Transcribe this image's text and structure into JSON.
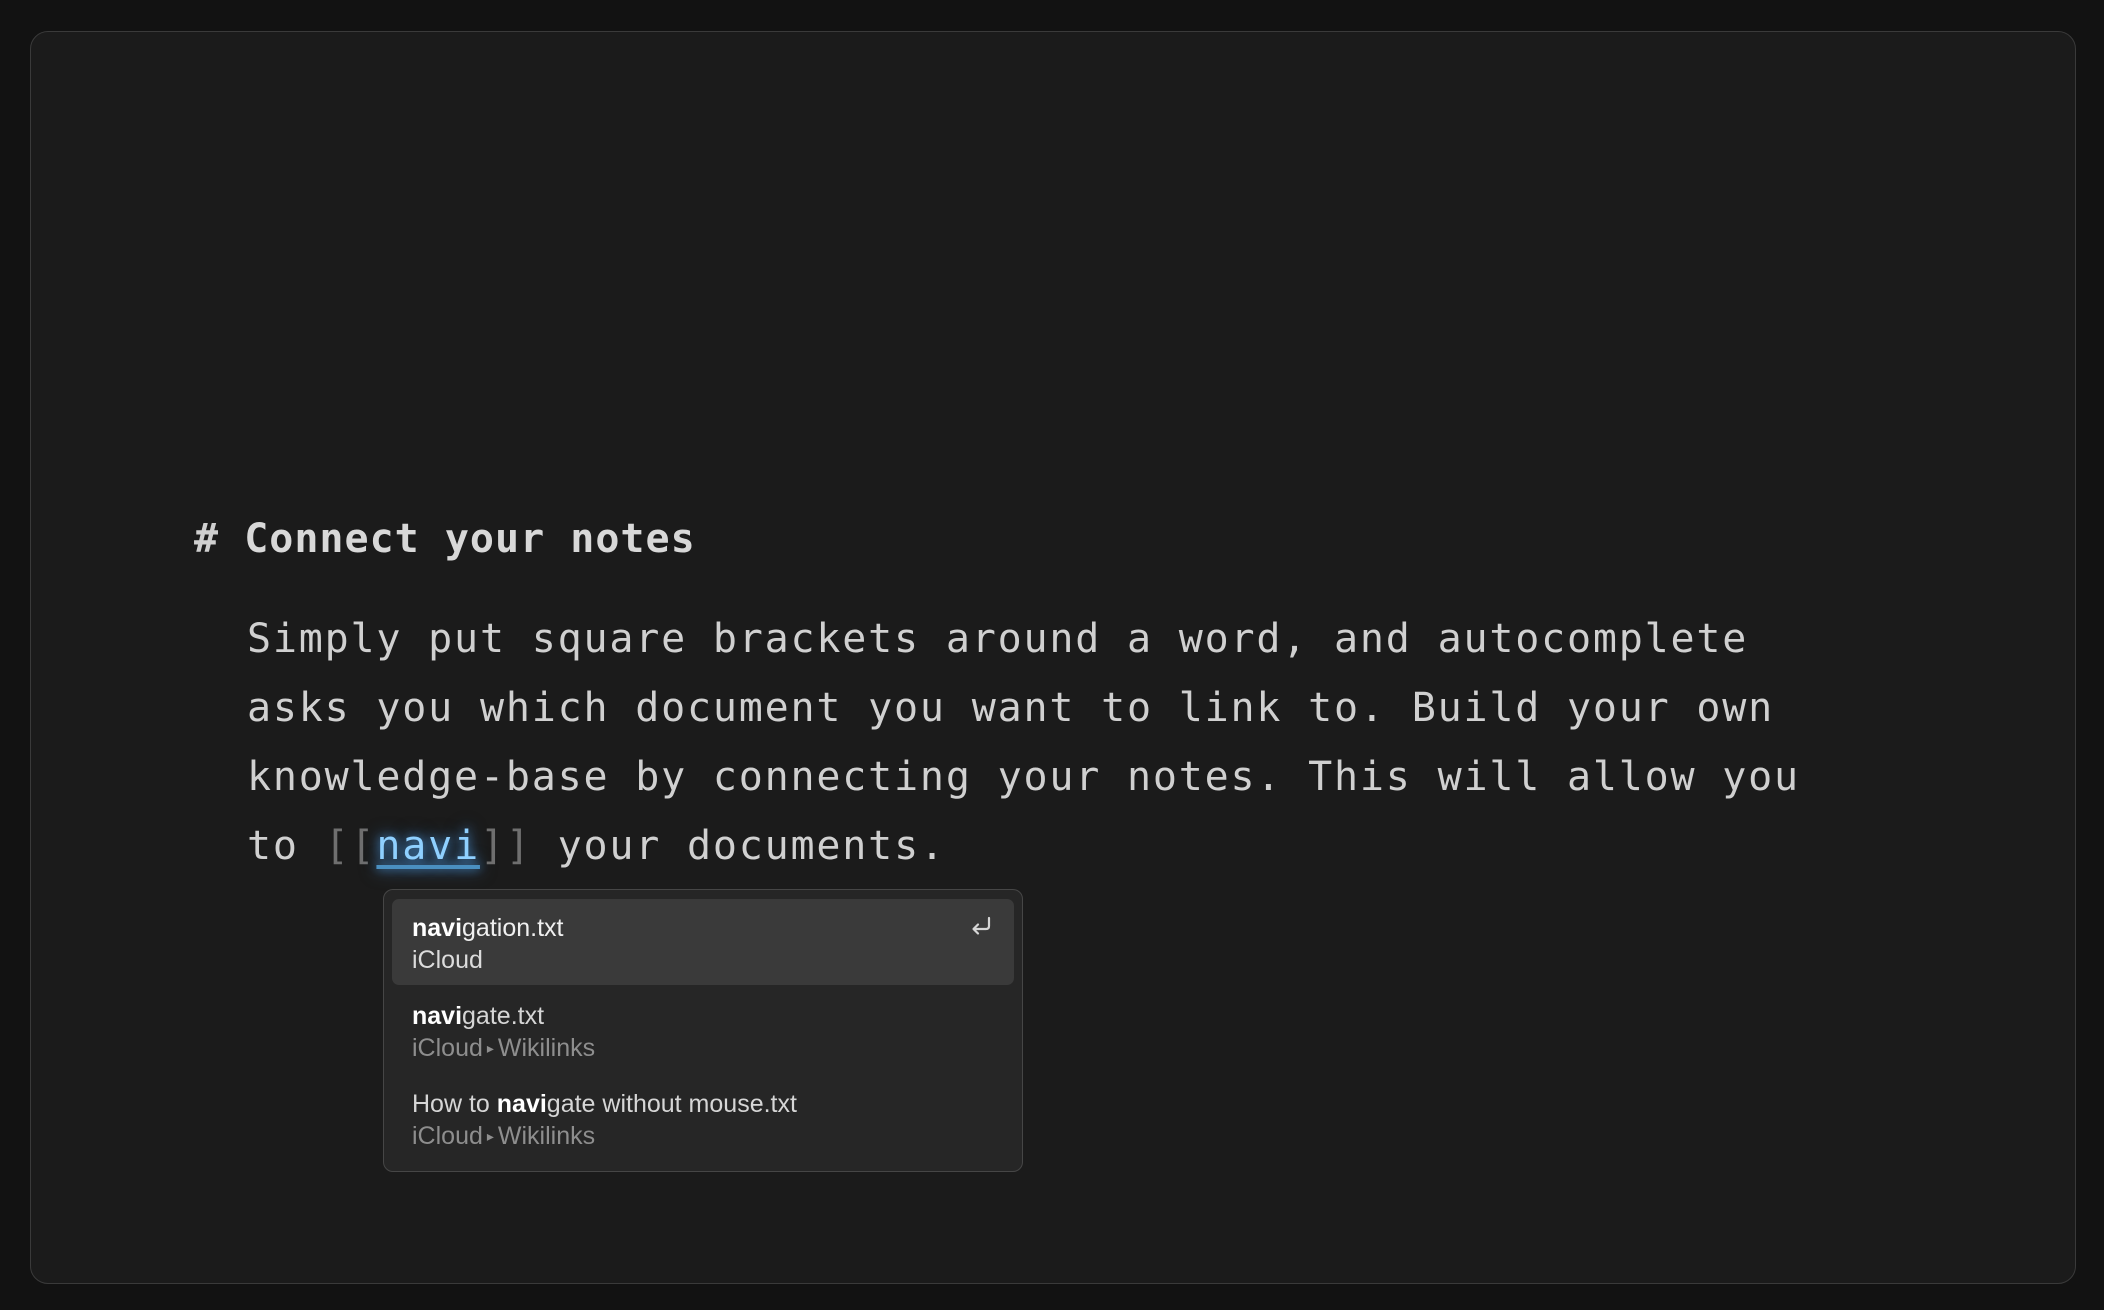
{
  "editor": {
    "heading": {
      "marker": "#",
      "text": "Connect your notes"
    },
    "paragraph": {
      "line1": "Simply put square brackets around a word, and autocomplete",
      "line2": "asks you which document you want to link to. Build your own",
      "line3": "knowledge-base by connecting your notes. This will allow you",
      "line4_prefix": "to ",
      "open_bracket": "[[",
      "query": "navi",
      "close_bracket": "]]",
      "line4_suffix": " your documents."
    }
  },
  "autocomplete": {
    "selected_index": 0,
    "enter_icon": "return-key-icon",
    "items": [
      {
        "title_before": "",
        "title_match": "navi",
        "title_after": "gation.txt",
        "location": [
          "iCloud"
        ]
      },
      {
        "title_before": "",
        "title_match": "navi",
        "title_after": "gate.txt",
        "location": [
          "iCloud",
          "Wikilinks"
        ]
      },
      {
        "title_before": "How to ",
        "title_match": "navi",
        "title_after": "gate without mouse.txt",
        "location": [
          "iCloud",
          "Wikilinks"
        ]
      }
    ],
    "path_separator": "▸"
  },
  "colors": {
    "background": "#1b1b1b",
    "text": "#d0d0d0",
    "bracket": "#6f6f6f",
    "link_glow": "#8fd0ff",
    "popup_bg": "#262626",
    "selected_bg": "#3a3a3a"
  }
}
